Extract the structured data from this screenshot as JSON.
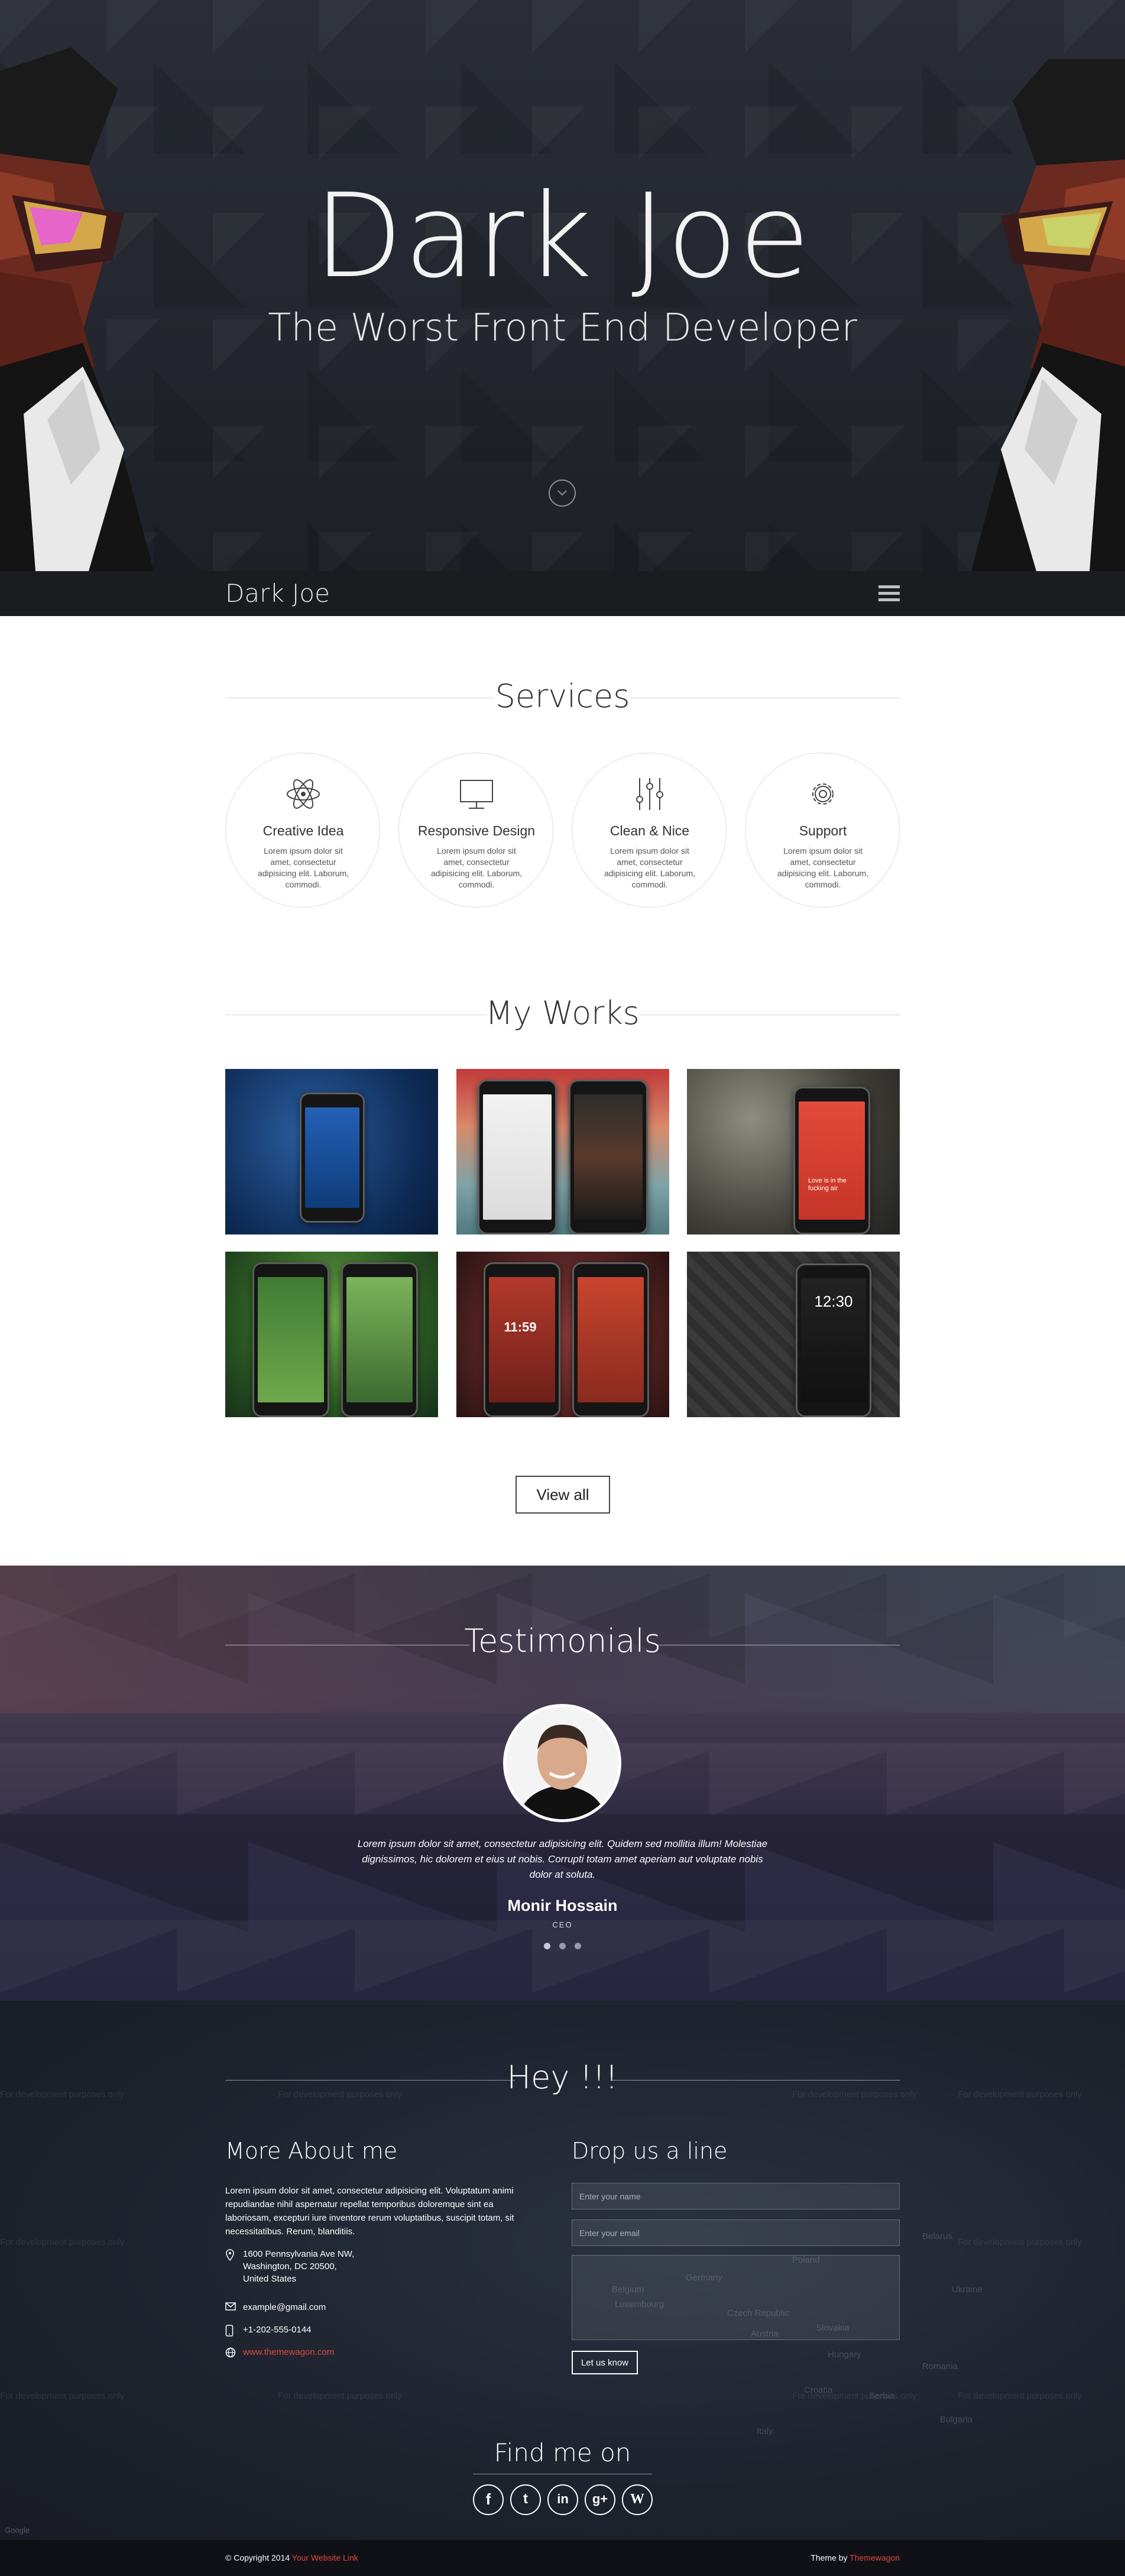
{
  "hero": {
    "title": "Dark Joe",
    "subtitle": "The Worst Front End Developer"
  },
  "navbar": {
    "brand": "Dark Joe",
    "menu_icon": "hamburger-menu-icon"
  },
  "services": {
    "title": "Services",
    "items": [
      {
        "icon": "atom-icon",
        "title": "Creative Idea",
        "desc": "Lorem ipsum dolor sit amet, consectetur adipisicing elit. Laborum, commodi."
      },
      {
        "icon": "monitor-icon",
        "title": "Responsive Design",
        "desc": "Lorem ipsum dolor sit amet, consectetur adipisicing elit. Laborum, commodi."
      },
      {
        "icon": "sliders-icon",
        "title": "Clean & Nice",
        "desc": "Lorem ipsum dolor sit amet, consectetur adipisicing elit. Laborum, commodi."
      },
      {
        "icon": "gear-icon",
        "title": "Support",
        "desc": "Lorem ipsum dolor sit amet, consectetur adipisicing elit. Laborum, commodi."
      }
    ]
  },
  "works": {
    "title": "My Works",
    "view_all_label": "View all",
    "screen_texts": [
      "11:59",
      "Love is in the fucking air",
      "12:30"
    ]
  },
  "testimonials": {
    "title": "Testimonials",
    "quote": "Lorem ipsum dolor sit amet, consectetur adipisicing elit. Quidem sed mollitia illum! Molestiae dignissimos, hic dolorem et eius ut nobis. Corrupti totam amet aperiam aut voluptate nobis dolor at soluta.",
    "name": "Monir Hossain",
    "role": "CEO",
    "dots": 3
  },
  "contact": {
    "title": "Hey !!!",
    "about_title": "More About me",
    "about_text": "Lorem ipsum dolor sit amet, consectetur adipisicing elit. Voluptatum animi repudiandae nihil aspernatur repellat temporibus doloremque sint ea laboriosam, excepturi iure inventore rerum voluptatibus, suscipit totam, sit necessitatibus. Rerum, blanditiis.",
    "address_line1": "1600 Pennsylvania Ave NW,",
    "address_line2": "Washington, DC 20500,",
    "address_line3": "United States",
    "email": "example@gmail.com",
    "phone": "+1-202-555-0144",
    "website": "www.themewagon.com",
    "form_title": "Drop us a line",
    "name_placeholder": "Enter your name",
    "email_placeholder": "Enter your email",
    "send_label": "Let us know",
    "map_watermark": "For development purposes only",
    "map_labels": [
      "Belgium",
      "Germany",
      "Luxembourg",
      "Czech Republic",
      "Austria",
      "Slovakia",
      "Hungary",
      "Poland",
      "Belarus",
      "Ukraine",
      "Romania",
      "Italy",
      "Croatia",
      "Serbia",
      "Bulgaria"
    ],
    "map_attribution": "Google"
  },
  "social": {
    "title": "Find me on",
    "icons": [
      "facebook-icon",
      "twitter-icon",
      "linkedin-icon",
      "googleplus-icon",
      "wordpress-icon"
    ],
    "glyphs": [
      "f",
      "t",
      "in",
      "g+",
      "W"
    ]
  },
  "footer": {
    "copyright_prefix": "© Copyright 2014",
    "copyright_link": "Your Website Link",
    "theme_prefix": "Theme by",
    "theme_link": "Themewagon"
  },
  "colors": {
    "accent_red": "#e0473c",
    "hero_bg": "#2a2d36",
    "nav_bg": "#1b1c20",
    "footer_bg": "#101116"
  }
}
